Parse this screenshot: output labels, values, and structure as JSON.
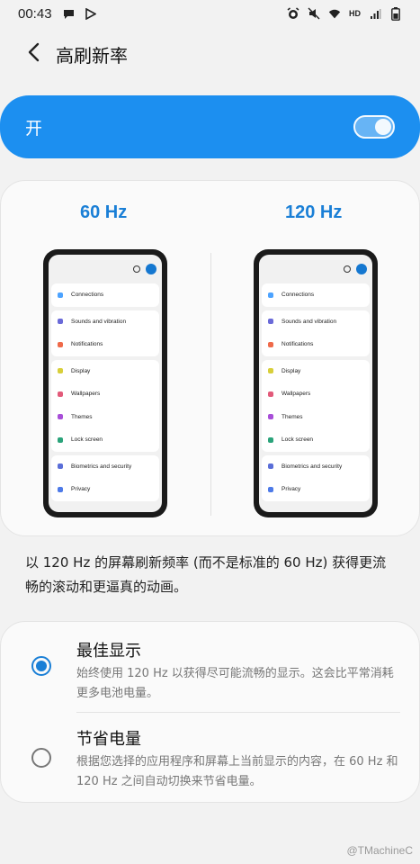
{
  "status_bar": {
    "time": "00:43",
    "network_label": "HD",
    "left_icons": [
      "message-icon",
      "play-store-icon"
    ],
    "right_icons": [
      "alarm-icon",
      "mute-icon",
      "wifi-icon",
      "hd-label",
      "signal-icon",
      "battery-icon"
    ]
  },
  "header": {
    "title": "高刷新率",
    "back_icon": "arrow-back-icon"
  },
  "master_switch": {
    "label": "开",
    "state": "on",
    "accent_color": "#1c8ff0"
  },
  "preview": {
    "left_label": "60 Hz",
    "right_label": "120 Hz",
    "menu_groups": [
      [
        {
          "label": "Connections",
          "color": "#4da3ff"
        }
      ],
      [
        {
          "label": "Sounds and vibration",
          "color": "#6a6ad8"
        },
        {
          "label": "Notifications",
          "color": "#ef6a4a"
        }
      ],
      [
        {
          "label": "Display",
          "color": "#d8cf3a"
        },
        {
          "label": "Wallpapers",
          "color": "#e25a7a"
        },
        {
          "label": "Themes",
          "color": "#a84ed8"
        },
        {
          "label": "Lock screen",
          "color": "#2aa37a"
        }
      ],
      [
        {
          "label": "Biometrics and security",
          "color": "#5a6ed8"
        },
        {
          "label": "Privacy",
          "color": "#4d7ae8"
        }
      ]
    ]
  },
  "description": "以 120 Hz 的屏幕刷新频率 (而不是标准的 60 Hz) 获得更流畅的滚动和更逼真的动画。",
  "options": [
    {
      "title": "最佳显示",
      "desc": "始终使用 120 Hz 以获得尽可能流畅的显示。这会比平常消耗更多电池电量。",
      "selected": true
    },
    {
      "title": "节省电量",
      "desc": "根据您选择的应用程序和屏幕上当前显示的内容，在 60 Hz 和 120 Hz 之间自动切换来节省电量。",
      "selected": false
    }
  ],
  "watermark": "@TMachineC"
}
